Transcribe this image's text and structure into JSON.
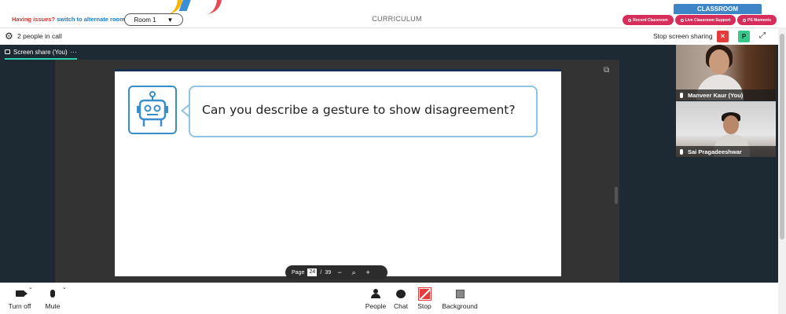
{
  "topbar": {
    "issue_text": "Having issues?",
    "issue_link": "switch to alternate room",
    "room_label": "Room 1",
    "section_title": "CURRICULUM",
    "classroom_label": "CLASSROOM",
    "buttons": [
      "Record Classroom",
      "Live Classroom Support",
      "PS Moments"
    ]
  },
  "call": {
    "people_count": "2 people in call",
    "stop_sharing_label": "Stop screen sharing",
    "p_label": "P"
  },
  "share": {
    "tab_label": "Screen share (You)",
    "tab_more": "···",
    "question": "Can you describe a gesture to show disagreement?"
  },
  "pager": {
    "page_label": "Page",
    "current_page": "24",
    "separator": "/",
    "total_pages": "39",
    "zoom_out": "−",
    "zoom_in": "+"
  },
  "participants": [
    {
      "name": "Manveer Kaur (You)"
    },
    {
      "name": "Sai Pragadeeshwar"
    }
  ],
  "toolbar": {
    "turn_off": "Turn off",
    "mute": "Mute",
    "people": "People",
    "chat": "Chat",
    "stop": "Stop",
    "background": "Background"
  },
  "colors": {
    "accent_teal": "#2ad1b0",
    "danger_red": "#e63b3b",
    "classroom_blue": "#3d85c6",
    "button_pink": "#d62d5a",
    "meeting_bg": "#1d2a33"
  },
  "icons": [
    "gear-icon",
    "close-icon",
    "expand-icon",
    "popout-icon",
    "robot-icon",
    "camera-icon",
    "mic-icon",
    "people-icon",
    "chat-icon",
    "stop-share-icon",
    "background-icon",
    "search-icon"
  ]
}
